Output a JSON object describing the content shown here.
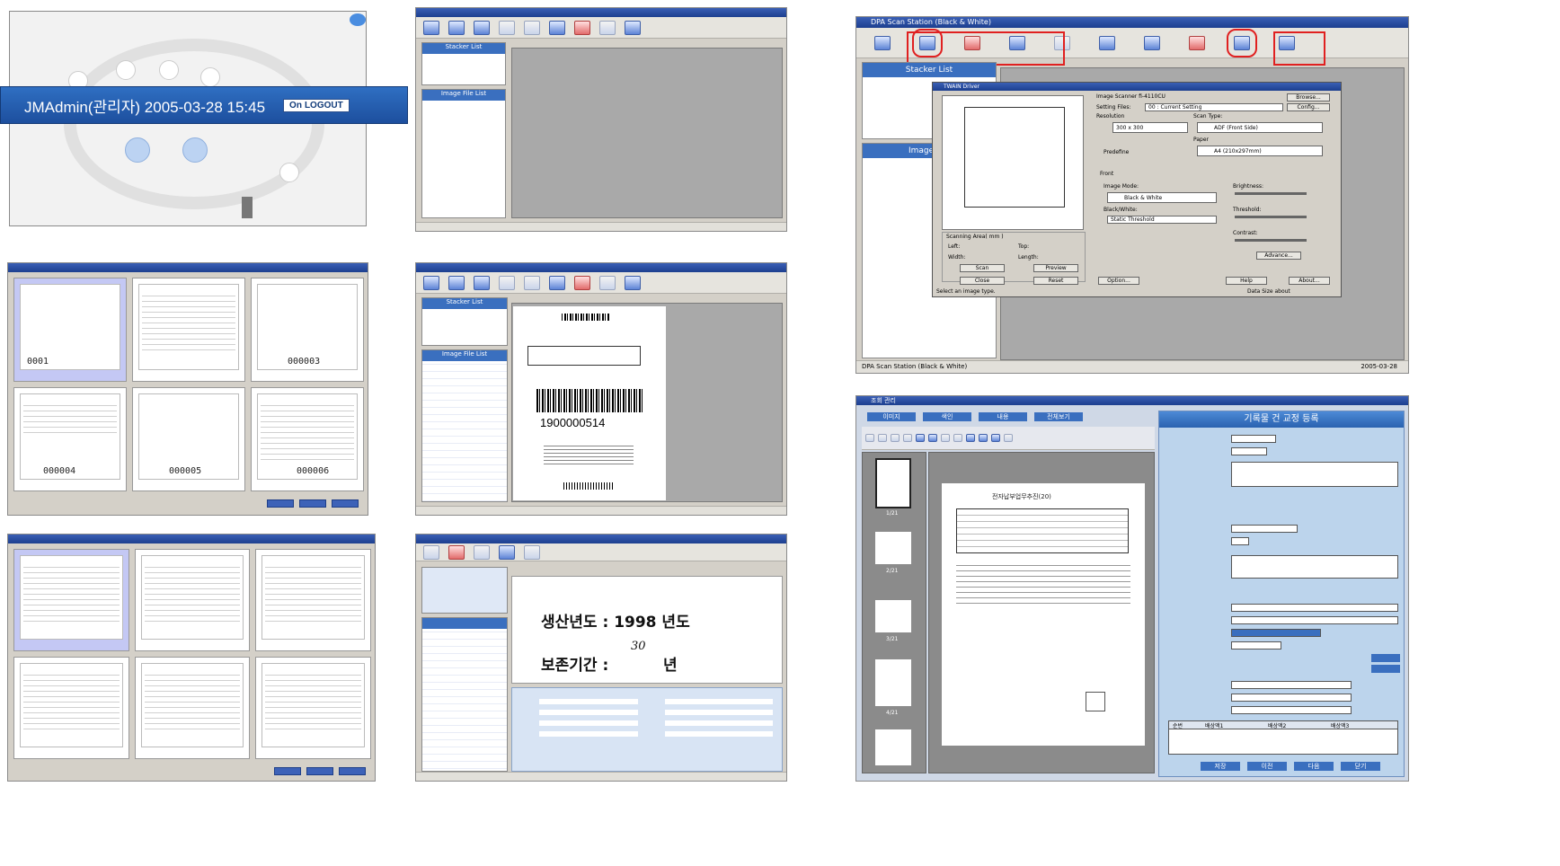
{
  "panel_login": {
    "banner_text": "JMAdmin(관리자) 2005-03-28 15:45",
    "logout_label": "LOGOUT",
    "logout_prefix": "On"
  },
  "panel_thumbs": {
    "labels": [
      "0001",
      "000003",
      "000004",
      "000005",
      "000006"
    ]
  },
  "panel_barcode": {
    "barcode_number": "1900000514",
    "stacker_header": "Stacker List",
    "image_header": "Image File List"
  },
  "panel_index": {
    "line1": "생산년도 : 1998 년도",
    "line2": "보존기간 :",
    "line2_value": "30",
    "line2_unit": "년"
  },
  "scan_station": {
    "title": "DPA Scan Station (Black & White)",
    "stacker_header": "Stacker List",
    "image_header": "Image File",
    "twain_title": "TWAIN Driver",
    "scanner_name": "Image Scanner fi-4110CU",
    "setting_files_label": "Setting Files:",
    "setting_files_value": "00 : Current Setting",
    "resolution_label": "Resolution",
    "resolution_value": "300 x 300",
    "scan_type_label": "Scan Type:",
    "scan_type_value": "ADF (Front Side)",
    "paper_label": "Paper",
    "paper_value": "A4 (210x297mm)",
    "predefine_label": "Predefine",
    "front_label": "Front",
    "image_mode_label": "Image Mode:",
    "image_mode_value": "Black & White",
    "bw_label": "Black/White:",
    "bw_value": "Static Threshold",
    "brightness_label": "Brightness:",
    "threshold_label": "Threshold:",
    "contrast_label": "Contrast:",
    "scan_area_label": "Scanning Area( mm )",
    "left_label": "Left:",
    "top_label": "Top:",
    "width_label": "Width:",
    "length_label": "Length:",
    "buttons": [
      "Scan",
      "Preview",
      "Close",
      "Reset",
      "Option...",
      "Help",
      "About...",
      "Advance...",
      "Browse...",
      "Config..."
    ],
    "status_hint": "Select an image type.",
    "data_size_label": "Data Size about",
    "status_left": "DPA Scan Station (Black & White)",
    "status_date": "2005-03-28"
  },
  "edit_window": {
    "title": "조회 관리",
    "right_title": "기록물 건 교정 등록",
    "tabs": [
      "이미지",
      "색인",
      "내용",
      "전체보기"
    ],
    "doc_heading": "전자납부업무추진(20)",
    "bottom_buttons": [
      "저장",
      "이전",
      "다음",
      "닫기"
    ],
    "table_header": [
      "순번",
      "배상액1",
      "배상액2",
      "배상액3"
    ],
    "page_labels": [
      "1/21",
      "2/21",
      "3/21",
      "4/21"
    ]
  }
}
